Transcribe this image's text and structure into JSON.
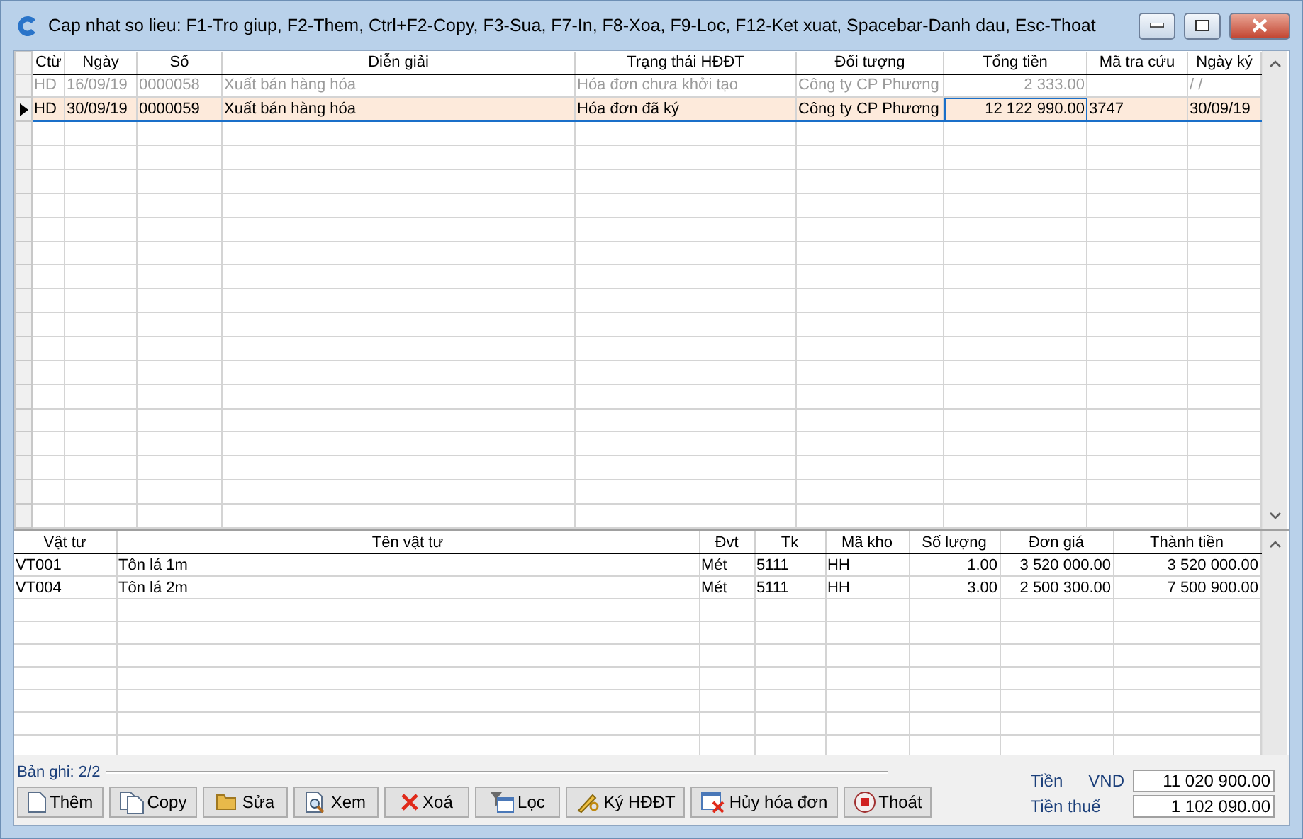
{
  "window": {
    "title": "Cap nhat so lieu: F1-Tro giup, F2-Them, Ctrl+F2-Copy, F3-Sua, F7-In, F8-Xoa, F9-Loc, F12-Ket xuat, Spacebar-Danh dau, Esc-Thoat"
  },
  "vouchers": {
    "columns": [
      {
        "label": "Ctừ",
        "kind": "text"
      },
      {
        "label": "Ngày",
        "kind": "text"
      },
      {
        "label": "Số",
        "kind": "text"
      },
      {
        "label": "Diễn giải",
        "kind": "text"
      },
      {
        "label": "Trạng thái HĐĐT",
        "kind": "text"
      },
      {
        "label": "Đối tượng",
        "kind": "text"
      },
      {
        "label": "Tổng tiền",
        "kind": "number"
      },
      {
        "label": "Mã tra cứu",
        "kind": "text"
      },
      {
        "label": "Ngày ký",
        "kind": "text"
      }
    ],
    "rows": [
      {
        "selected": false,
        "dimmed": true,
        "cells": [
          "HD",
          "16/09/19",
          "0000058",
          "Xuất bán hàng hóa",
          "Hóa đơn chưa khởi tạo",
          "Công ty CP Phương",
          "2 333.00",
          "",
          "/  /"
        ]
      },
      {
        "selected": true,
        "dimmed": false,
        "cells": [
          "HD",
          "30/09/19",
          "0000059",
          "Xuất bán hàng hóa",
          "Hóa đơn đã ký",
          "Công ty CP Phương",
          "12 122 990.00",
          "3747",
          "30/09/19"
        ]
      }
    ]
  },
  "items": {
    "columns": [
      {
        "label": "Vật tư",
        "kind": "text"
      },
      {
        "label": "Tên vật tư",
        "kind": "text"
      },
      {
        "label": "Đvt",
        "kind": "text"
      },
      {
        "label": "Tk",
        "kind": "text"
      },
      {
        "label": "Mã kho",
        "kind": "text"
      },
      {
        "label": "Số lượng",
        "kind": "number"
      },
      {
        "label": "Đơn giá",
        "kind": "number"
      },
      {
        "label": "Thành tiền",
        "kind": "number"
      }
    ],
    "rows": [
      {
        "cells": [
          "VT001",
          "Tôn lá 1m",
          "Mét",
          "5111",
          "HH",
          "1.00",
          "3 520 000.00",
          "3 520 000.00"
        ]
      },
      {
        "cells": [
          "VT004",
          "Tôn lá 2m",
          "Mét",
          "5111",
          "HH",
          "3.00",
          "2 500 300.00",
          "7 500 900.00"
        ]
      }
    ]
  },
  "record_count": "Bản ghi: 2/2",
  "buttons": [
    {
      "kind": "add",
      "label": "Thêm"
    },
    {
      "kind": "copy",
      "label": "Copy"
    },
    {
      "kind": "edit",
      "label": "Sửa"
    },
    {
      "kind": "view",
      "label": "Xem"
    },
    {
      "kind": "delete",
      "label": "Xoá"
    },
    {
      "kind": "filter",
      "label": "Lọc"
    },
    {
      "kind": "sign",
      "label": "Ký HĐĐT"
    },
    {
      "kind": "cancel",
      "label": "Hủy hóa đơn"
    },
    {
      "kind": "exit",
      "label": "Thoát"
    }
  ],
  "totals": {
    "amount_label": "Tiền",
    "currency": "VND",
    "amount": "11 020 900.00",
    "tax_label": "Tiền thuế",
    "tax": "1 102 090.00"
  }
}
